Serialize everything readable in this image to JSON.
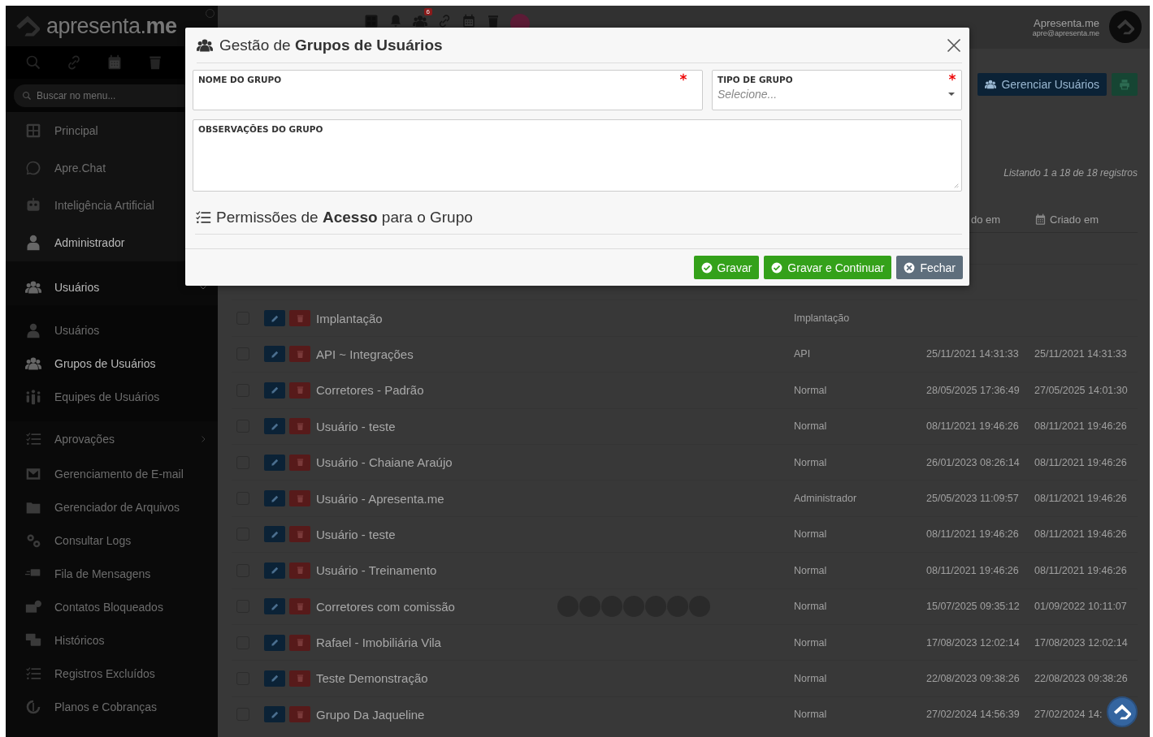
{
  "sidebar": {
    "logo": "apresenta.**me**",
    "search": {
      "placeholder": "Buscar no menu..."
    },
    "sections": [
      {
        "items": [
          {
            "label": "Principal",
            "selected": false
          },
          {
            "label": "Apre.Chat",
            "selected": false
          },
          {
            "label": "Inteligência Artificial",
            "selected": false
          },
          {
            "label": "Administrador",
            "selected": true
          }
        ]
      },
      {
        "items": [
          {
            "label": "Usuários",
            "selected": true,
            "expanded": true,
            "children": [
              {
                "label": "Usuários",
                "selected": false
              },
              {
                "label": "Grupos de Usuários",
                "selected": true
              },
              {
                "label": "Equipes de Usuários",
                "selected": false
              }
            ]
          },
          {
            "label": "Aprovações",
            "selected": false,
            "expanded": false
          },
          {
            "label": "Gerenciamento de E-mail",
            "selected": false
          },
          {
            "label": "Gerenciador de Arquivos",
            "selected": false
          },
          {
            "label": "Consultar Logs",
            "selected": false
          },
          {
            "label": "Fila de Mensagens",
            "selected": false
          },
          {
            "label": "Contatos Bloqueados",
            "selected": false
          },
          {
            "label": "Históricos",
            "selected": false
          },
          {
            "label": "Registros Excluídos",
            "selected": false
          },
          {
            "label": "Planos e Cobranças",
            "selected": false
          }
        ]
      }
    ]
  },
  "topbar": {
    "notification_badge": "6",
    "user": {
      "name": "Apresenta.me",
      "email": "apre@apresenta.me"
    }
  },
  "toolbar": {
    "buttons": [
      {
        "kind": "primary",
        "label": "Gerenciar Usuários"
      },
      {
        "kind": "print"
      }
    ]
  },
  "listing": {
    "summary": "Listando 1 a 18 de 18 registros",
    "columns": [
      {
        "label": "do em"
      },
      {
        "label": "Criado em"
      }
    ],
    "rows": [
      {
        "checked": false,
        "name": "Implantação",
        "type": "Implantação"
      },
      {
        "checked": false,
        "name": "API ~ Integrações",
        "type": "API",
        "updated": "25/11/2021 14:31:33",
        "created": "25/11/2021 14:31:33"
      },
      {
        "checked": false,
        "name": "Corretores - Padrão",
        "type": "Normal",
        "updated": "28/05/2025 17:36:49",
        "created": "27/05/2025 14:01:30"
      },
      {
        "checked": false,
        "name": "Usuário - teste",
        "type": "Normal",
        "updated": "08/11/2021 19:46:26",
        "created": "08/11/2021 19:46:26"
      },
      {
        "checked": false,
        "name": "Usuário - Chaiane Araújo",
        "type": "Normal",
        "updated": "26/01/2023 08:26:14",
        "created": "08/11/2021 19:46:26"
      },
      {
        "checked": false,
        "name": "Usuário - Apresenta.me",
        "type": "Administrador",
        "updated": "25/05/2023 11:09:57",
        "created": "08/11/2021 19:46:26"
      },
      {
        "checked": false,
        "name": "Usuário - teste",
        "type": "Normal",
        "updated": "08/11/2021 19:46:26",
        "created": "08/11/2021 19:46:26"
      },
      {
        "checked": false,
        "name": "Usuário - Treinamento",
        "type": "Normal",
        "updated": "08/11/2021 19:46:26",
        "created": "08/11/2021 19:46:26"
      },
      {
        "checked": false,
        "name": "Corretores com comissão",
        "photos": [
          {
            "kind": "person"
          },
          {
            "kind": "person"
          },
          {
            "kind": "person"
          },
          {
            "kind": "person"
          },
          {
            "kind": "person"
          },
          {
            "kind": "person"
          },
          {
            "kind": "person"
          }
        ],
        "type": "Normal",
        "updated": "15/07/2025 09:35:12",
        "created": "01/09/2022 10:11:07"
      },
      {
        "checked": false,
        "name": "Rafael - Imobiliária Vila",
        "type": "Normal",
        "updated": "17/08/2023 12:02:14",
        "created": "17/08/2023 12:02:14"
      },
      {
        "checked": false,
        "name": "Teste Demonstração",
        "type": "Normal",
        "updated": "22/08/2023 09:38:26",
        "created": "22/08/2023 09:38:26"
      },
      {
        "checked": false,
        "name": "Grupo Da Jaqueline",
        "type": "Normal",
        "updated": "27/02/2024 14:56:39",
        "created": "27/02/2024 14:"
      }
    ]
  },
  "modal": {
    "title": "Gestão de **Grupos de Usuários**",
    "fields": [
      {
        "kind": "text",
        "label": "NOME DO GRUPO",
        "required": true
      },
      {
        "kind": "select",
        "label": "TIPO DE GRUPO",
        "required": true,
        "placeholder": "Selecione..."
      },
      {
        "kind": "textarea",
        "label": "OBSERVAÇÕES DO GRUPO",
        "required": false
      }
    ],
    "section": "Permissões de **Acesso** para o Grupo",
    "buttons": [
      {
        "kind": "save",
        "label": "Gravar"
      },
      {
        "kind": "save",
        "label": "Gravar e Continuar"
      },
      {
        "kind": "close",
        "label": "Fechar"
      }
    ]
  }
}
